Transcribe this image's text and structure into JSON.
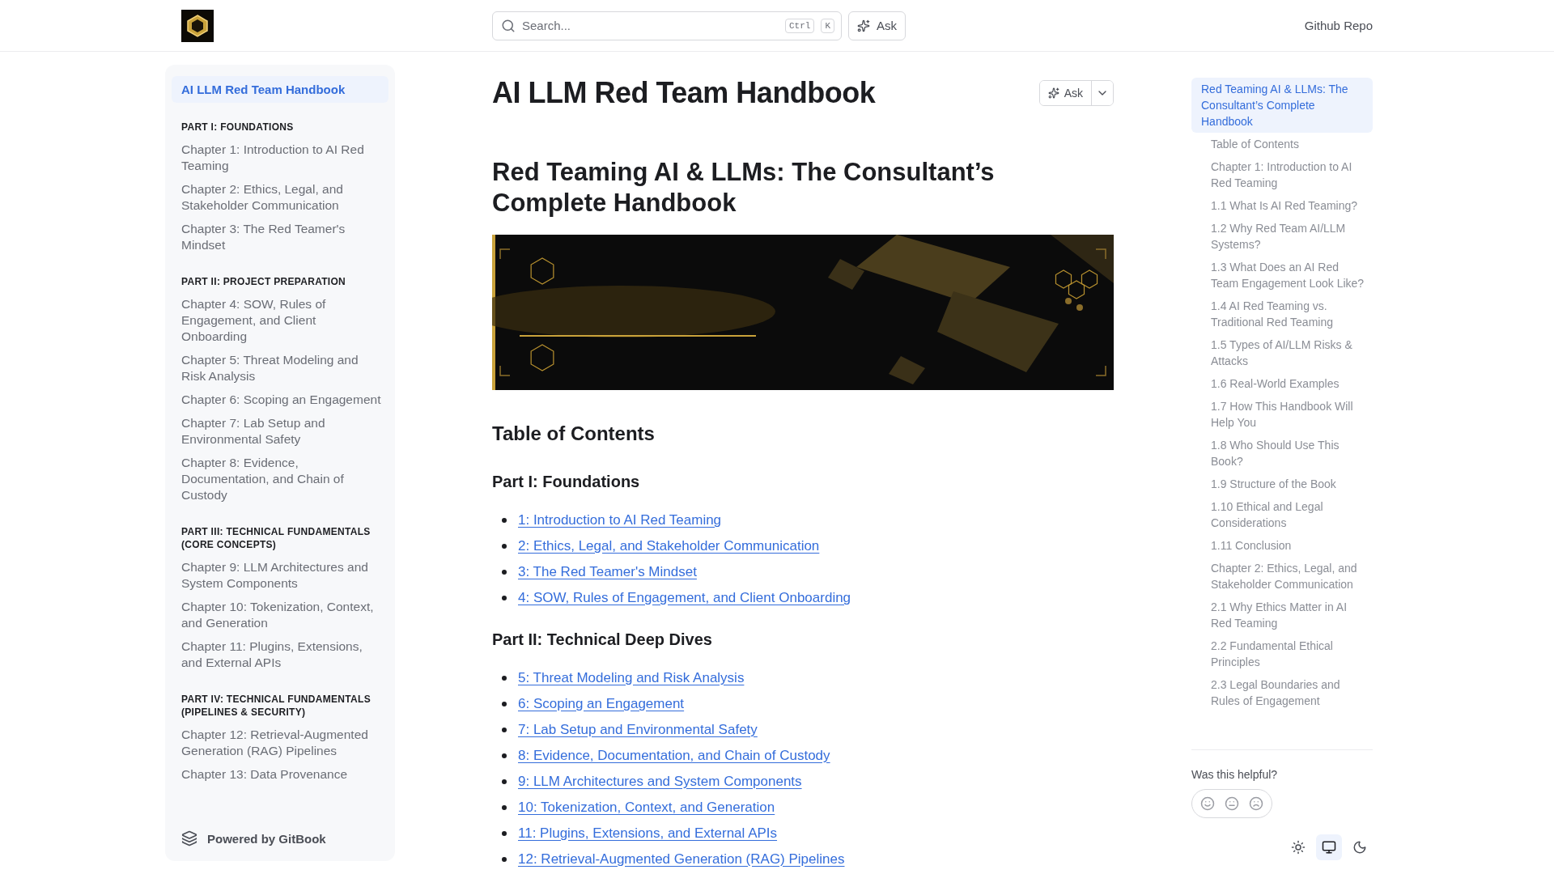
{
  "header": {
    "search": {
      "placeholder": "Search...",
      "shortcut": [
        "Ctrl",
        "K"
      ]
    },
    "ask_button": "Ask",
    "links": [
      "Github Repo"
    ]
  },
  "sidebar": {
    "title_item": {
      "label": "AI LLM Red Team Handbook",
      "selected": true
    },
    "sections": [
      {
        "heading": "PART I: FOUNDATIONS",
        "items": [
          {
            "label": "Chapter 1: Introduction to AI Red Teaming",
            "selected": false
          },
          {
            "label": "Chapter 2: Ethics, Legal, and Stakeholder Communication",
            "selected": false
          },
          {
            "label": "Chapter 3: The Red Teamer's Mindset",
            "selected": false
          }
        ]
      },
      {
        "heading": "PART II: PROJECT PREPARATION",
        "items": [
          {
            "label": "Chapter 4: SOW, Rules of Engagement, and Client Onboarding",
            "selected": false
          },
          {
            "label": "Chapter 5: Threat Modeling and Risk Analysis",
            "selected": false
          },
          {
            "label": "Chapter 6: Scoping an Engagement",
            "selected": false
          },
          {
            "label": "Chapter 7: Lab Setup and Environmental Safety",
            "selected": false
          },
          {
            "label": "Chapter 8: Evidence, Documentation, and Chain of Custody",
            "selected": false
          }
        ]
      },
      {
        "heading": "PART III: TECHNICAL FUNDAMENTALS (CORE CONCEPTS)",
        "items": [
          {
            "label": "Chapter 9: LLM Architectures and System Components",
            "selected": false
          },
          {
            "label": "Chapter 10: Tokenization, Context, and Generation",
            "selected": false
          },
          {
            "label": "Chapter 11: Plugins, Extensions, and External APIs",
            "selected": false
          }
        ]
      },
      {
        "heading": "PART IV: TECHNICAL FUNDAMENTALS (PIPELINES & SECURITY)",
        "items": [
          {
            "label": "Chapter 12: Retrieval-Augmented Generation (RAG) Pipelines",
            "selected": false
          },
          {
            "label": "Chapter 13: Data Provenance",
            "selected": false
          }
        ]
      }
    ],
    "footer": "Powered by GitBook"
  },
  "page": {
    "title": "AI LLM Red Team Handbook",
    "ask_button": "Ask",
    "heading": "Red Teaming AI & LLMs: The Consultant’s Complete Handbook",
    "toc_heading": "Table of Contents",
    "parts": [
      {
        "title": "Part I: Foundations",
        "links": [
          "1: Introduction to AI Red Teaming",
          "2: Ethics, Legal, and Stakeholder Communication",
          "3: The Red Teamer's Mindset",
          "4: SOW, Rules of Engagement, and Client Onboarding"
        ]
      },
      {
        "title": "Part II: Technical Deep Dives",
        "links": [
          "5: Threat Modeling and Risk Analysis",
          "6: Scoping an Engagement",
          "7: Lab Setup and Environmental Safety",
          "8: Evidence, Documentation, and Chain of Custody",
          "9: LLM Architectures and System Components",
          "10: Tokenization, Context, and Generation",
          "11: Plugins, Extensions, and External APIs",
          "12: Retrieval-Augmented Generation (RAG) Pipelines"
        ]
      }
    ]
  },
  "outline": {
    "items": [
      {
        "label": "Red Teaming AI & LLMs: The Consultant’s Complete Handbook",
        "selected": true,
        "children": [
          {
            "label": "Table of Contents",
            "selected": false
          },
          {
            "label": "Chapter 1: Introduction to AI Red Teaming",
            "selected": false
          },
          {
            "label": "1.1 What Is AI Red Teaming?",
            "selected": false
          },
          {
            "label": "1.2 Why Red Team AI/LLM Systems?",
            "selected": false
          },
          {
            "label": "1.3 What Does an AI Red Team Engagement Look Like?",
            "selected": false
          },
          {
            "label": "1.4 AI Red Teaming vs. Traditional Red Teaming",
            "selected": false
          },
          {
            "label": "1.5 Types of AI/LLM Risks & Attacks",
            "selected": false
          },
          {
            "label": "1.6 Real-World Examples",
            "selected": false
          },
          {
            "label": "1.7 How This Handbook Will Help You",
            "selected": false
          },
          {
            "label": "1.8 Who Should Use This Book?",
            "selected": false
          },
          {
            "label": "1.9 Structure of the Book",
            "selected": false
          },
          {
            "label": "1.10 Ethical and Legal Considerations",
            "selected": false
          },
          {
            "label": "1.11 Conclusion",
            "selected": false
          },
          {
            "label": "Chapter 2: Ethics, Legal, and Stakeholder Communication",
            "selected": false
          },
          {
            "label": "2.1 Why Ethics Matter in AI Red Teaming",
            "selected": false
          },
          {
            "label": "2.2 Fundamental Ethical Principles",
            "selected": false
          },
          {
            "label": "2.3 Legal Boundaries and Rules of Engagement",
            "selected": false
          }
        ]
      }
    ]
  },
  "feedback": {
    "question": "Was this helpful?",
    "options": [
      {
        "kind": "happy"
      },
      {
        "kind": "neutral"
      },
      {
        "kind": "sad"
      }
    ]
  },
  "theme_modes": [
    {
      "kind": "light",
      "selected": false
    },
    {
      "kind": "system",
      "selected": true
    },
    {
      "kind": "dark",
      "selected": false
    }
  ]
}
